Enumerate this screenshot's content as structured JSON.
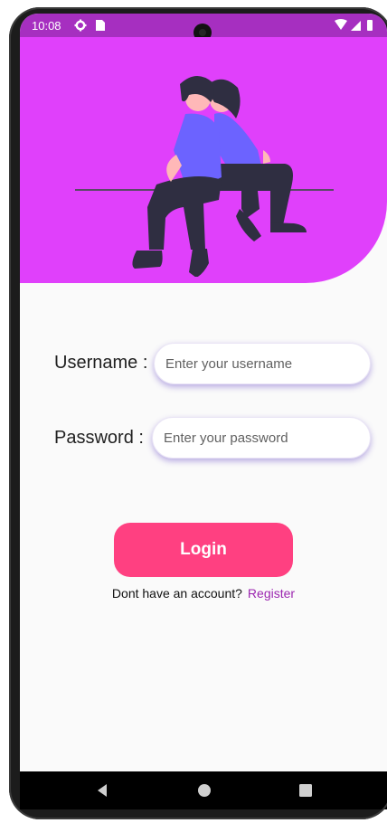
{
  "status_bar": {
    "time": "10:08",
    "left_icons": [
      "settings-icon",
      "sd-card-icon"
    ],
    "right_icons": [
      "wifi-icon",
      "signal-icon",
      "battery-icon"
    ]
  },
  "colors": {
    "hero": "#e040fb",
    "status_bar": "#a62fc0",
    "button": "#ff4081",
    "link": "#9c27b0",
    "figure_shirt": "#6c63ff",
    "figure_pants": "#2f2e41",
    "figure_skin": "#ffb8b8"
  },
  "form": {
    "username_label": "Username :",
    "username_placeholder": "Enter your username",
    "username_value": "",
    "password_label": "Password :",
    "password_placeholder": "Enter your password",
    "password_value": ""
  },
  "login_button": "Login",
  "register": {
    "prompt": "Dont have an account?",
    "link": "Register"
  },
  "nav_bar": {
    "icons": [
      "back-icon",
      "home-icon",
      "recents-icon"
    ]
  }
}
